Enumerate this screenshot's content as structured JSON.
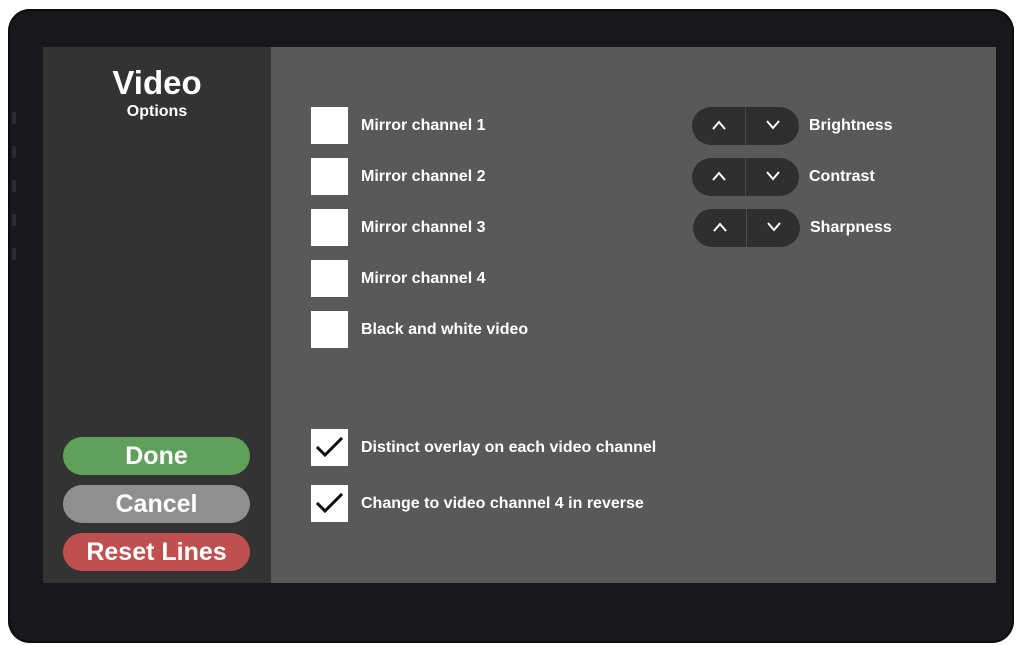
{
  "sidebar": {
    "title": "Video",
    "subtitle": "Options",
    "done_label": "Done",
    "cancel_label": "Cancel",
    "reset_label": "Reset Lines"
  },
  "options": {
    "mirror1": {
      "label": "Mirror channel 1",
      "checked": false
    },
    "mirror2": {
      "label": "Mirror channel 2",
      "checked": false
    },
    "mirror3": {
      "label": "Mirror channel 3",
      "checked": false
    },
    "mirror4": {
      "label": "Mirror channel 4",
      "checked": false
    },
    "bw": {
      "label": "Black and white video",
      "checked": false
    },
    "overlay": {
      "label": "Distinct overlay on each video channel",
      "checked": true
    },
    "reverse": {
      "label": "Change to video channel 4 in reverse",
      "checked": true
    }
  },
  "adjust": {
    "brightness": "Brightness",
    "contrast": "Contrast",
    "sharpness": "Sharpness",
    "up_icon": "chevron-up-icon",
    "down_icon": "chevron-down-icon"
  },
  "colors": {
    "done": "#5fa15a",
    "cancel": "#8f8f8f",
    "reset": "#c0504f",
    "panel": "#333333",
    "content": "#595959",
    "bezel": "#16181c"
  }
}
